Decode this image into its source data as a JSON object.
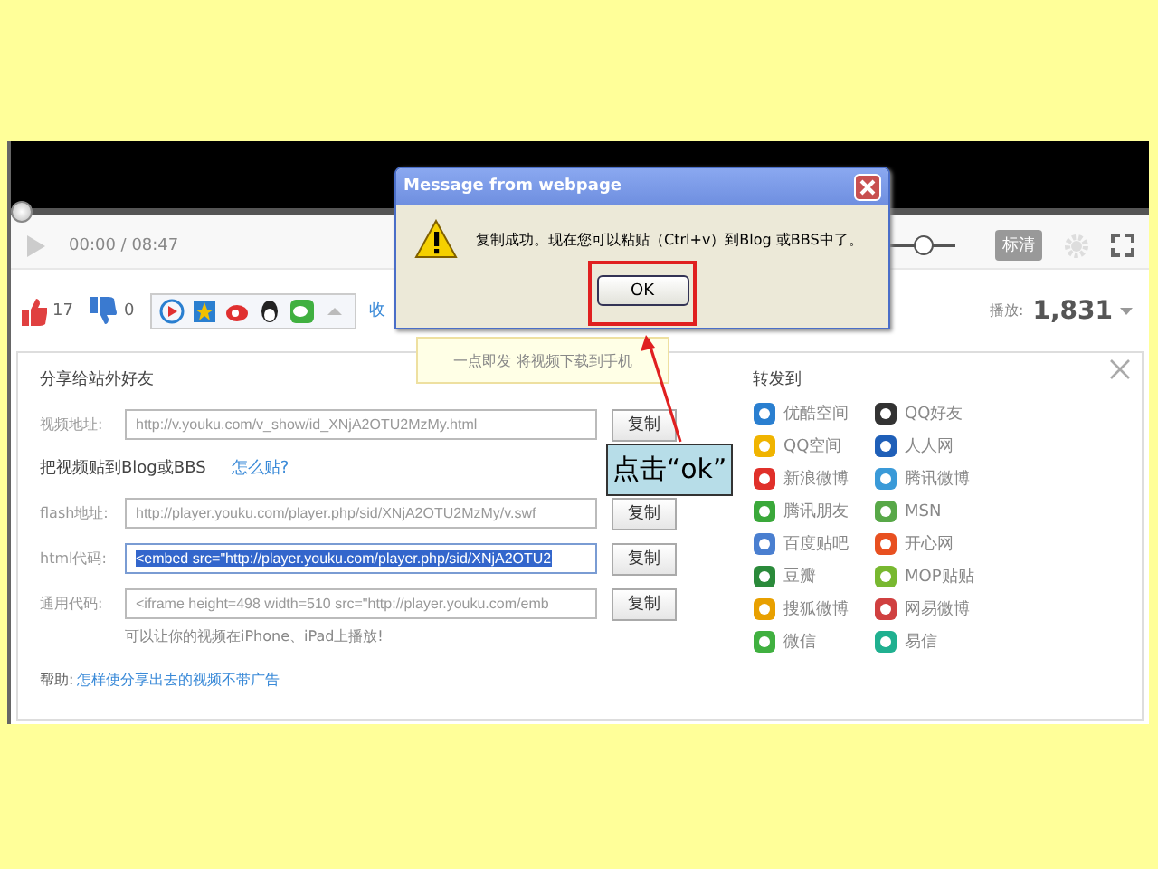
{
  "player": {
    "progress": {
      "level": 0
    },
    "time": "00:00 / 08:47",
    "volume": {
      "level": 0.6
    },
    "quality": "标清"
  },
  "actions": {
    "likes": "17",
    "dislikes": "0",
    "collect": "收",
    "plays_label": "播放:",
    "plays": "1,831"
  },
  "tooltip": "一点即发 将视频下载到手机",
  "share": {
    "title": "分享给站外好友",
    "friend_field": {
      "label": "视频地址:",
      "value": "http://v.youku.com/v_show/id_XNjA2OTU2MzMy.html",
      "button": "复制",
      "selected": false
    },
    "blog_heading": "把视频贴到Blog或BBS",
    "blog_help": "怎么贴?",
    "blog_fields": [
      {
        "label": "flash地址:",
        "value": "http://player.youku.com/player.php/sid/XNjA2OTU2MzMy/v.swf",
        "button": "复制",
        "selected": false
      },
      {
        "label": "html代码:",
        "value": "<embed src=\"http://player.youku.com/player.php/sid/XNjA2OTU2",
        "button": "复制",
        "selected": true
      },
      {
        "label": "通用代码:",
        "value": "<iframe height=498 width=510 src=\"http://player.youku.com/emb",
        "button": "复制",
        "selected": false
      }
    ],
    "note": "可以让你的视频在iPhone、iPad上播放!",
    "help_label": "帮助:",
    "help_link": "怎样使分享出去的视频不带广告",
    "forward_title": "转发到",
    "services": [
      {
        "name": "优酷空间",
        "color": "#2a7fd0"
      },
      {
        "name": "QQ好友",
        "color": "#333333"
      },
      {
        "name": "QQ空间",
        "color": "#f0b400"
      },
      {
        "name": "人人网",
        "color": "#1f5fb8"
      },
      {
        "name": "新浪微博",
        "color": "#e0302a"
      },
      {
        "name": "腾讯微博",
        "color": "#3a9ad8"
      },
      {
        "name": "腾讯朋友",
        "color": "#3aa83a"
      },
      {
        "name": "MSN",
        "color": "#58a848"
      },
      {
        "name": "百度贴吧",
        "color": "#4a7fd0"
      },
      {
        "name": "开心网",
        "color": "#e85020"
      },
      {
        "name": "豆瓣",
        "color": "#2a8a3a"
      },
      {
        "name": "MOP贴贴",
        "color": "#78b830"
      },
      {
        "name": "搜狐微博",
        "color": "#e8a000"
      },
      {
        "name": "网易微博",
        "color": "#d04040"
      },
      {
        "name": "微信",
        "color": "#40b040"
      },
      {
        "name": "易信",
        "color": "#20b090"
      }
    ]
  },
  "dialog": {
    "title": "Message from webpage",
    "message": "复制成功。现在您可以粘贴（Ctrl+v）到Blog 或BBS中了。",
    "button": "OK"
  },
  "callout": "点击“ok”"
}
